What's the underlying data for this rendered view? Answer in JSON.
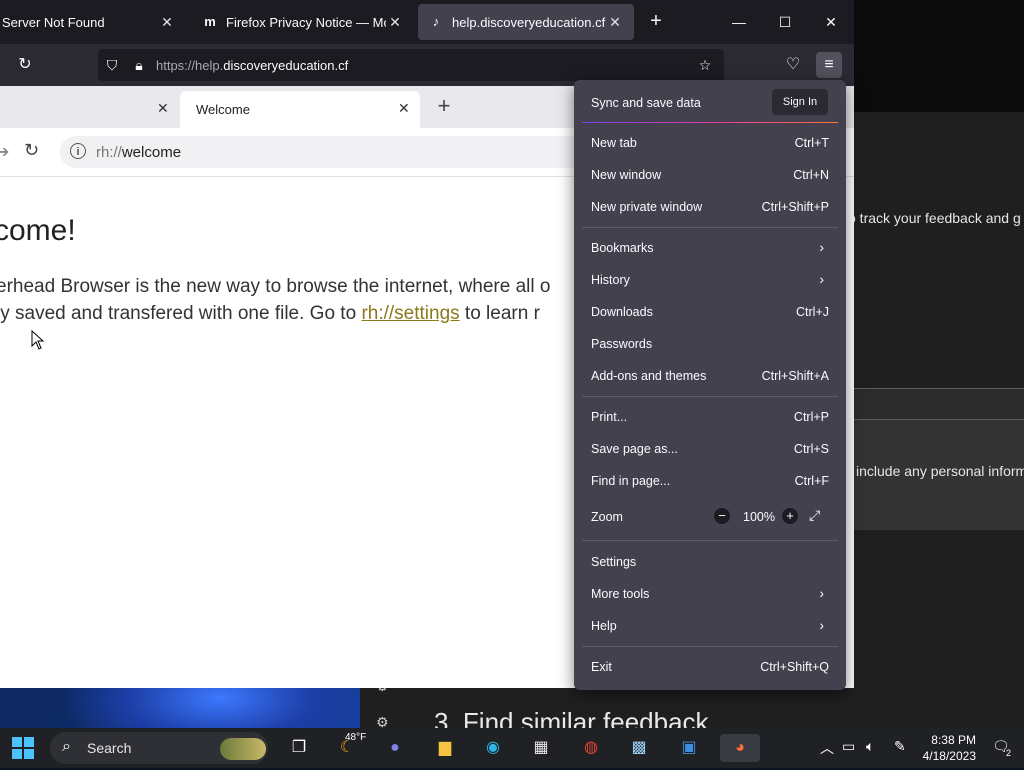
{
  "window": {
    "tabs": [
      {
        "title": "Server Not Found",
        "active": false
      },
      {
        "title": "Firefox Privacy Notice — Mozill",
        "favicon": "m",
        "active": false
      },
      {
        "title": "help.discoveryeducation.cf",
        "favicon": "♪",
        "active": true
      }
    ],
    "new_tab_label": "+",
    "controls": {
      "minimize": "—",
      "maximize": "☐",
      "close": "✕"
    }
  },
  "navbar": {
    "url_prefix": "https://help.",
    "url_domain": "discoveryeducation.cf",
    "icons": [
      "reload-icon",
      "shield-icon",
      "lock-icon",
      "star-icon",
      "pocket-icon",
      "hamburger-menu-icon"
    ]
  },
  "inner": {
    "tab_title": "Welcome",
    "address_prefix": "rh://",
    "address_main": "welcome",
    "heading": "come!",
    "line1": "erhead Browser is the new way to browse the internet, where all o",
    "line2_pre": "ly saved and transfered with one file. Go to ",
    "line2_link": "rh://settings",
    "line2_post": " to learn r"
  },
  "background_page": {
    "text1": "o track your feedback and g",
    "text2": "include any personal inform",
    "heading": "3. Find similar feedback"
  },
  "menu": {
    "sync_title": "Sync and save data",
    "sign_in": "Sign In",
    "items": [
      {
        "label": "New tab",
        "shortcut": "Ctrl+T"
      },
      {
        "label": "New window",
        "shortcut": "Ctrl+N"
      },
      {
        "label": "New private window",
        "shortcut": "Ctrl+Shift+P"
      },
      {
        "label": "Bookmarks",
        "shortcut": ""
      },
      {
        "label": "History",
        "shortcut": ""
      },
      {
        "label": "Downloads",
        "shortcut": "Ctrl+J"
      },
      {
        "label": "Passwords",
        "shortcut": ""
      },
      {
        "label": "Add-ons and themes",
        "shortcut": "Ctrl+Shift+A"
      },
      {
        "label": "Print...",
        "shortcut": "Ctrl+P"
      },
      {
        "label": "Save page as...",
        "shortcut": "Ctrl+S"
      },
      {
        "label": "Find in page...",
        "shortcut": "Ctrl+F"
      },
      {
        "label": "Zoom",
        "shortcut": ""
      },
      {
        "label": "Settings",
        "shortcut": ""
      },
      {
        "label": "More tools",
        "shortcut": ""
      },
      {
        "label": "Help",
        "shortcut": ""
      },
      {
        "label": "Exit",
        "shortcut": "Ctrl+Shift+Q"
      }
    ],
    "zoom": {
      "minus": "−",
      "value": "100%",
      "plus": "+"
    }
  },
  "taskbar": {
    "search_label": "Search",
    "weather": "48°F",
    "time": "8:38 PM",
    "date": "4/18/2023",
    "notification_count": "2"
  },
  "colors": {
    "menu_bg": "#42414d",
    "toolbar_bg": "#2b2a33",
    "tabbar_bg": "#1c1b22",
    "link": "#8a7a1a",
    "accent": "#4cc2ff"
  }
}
